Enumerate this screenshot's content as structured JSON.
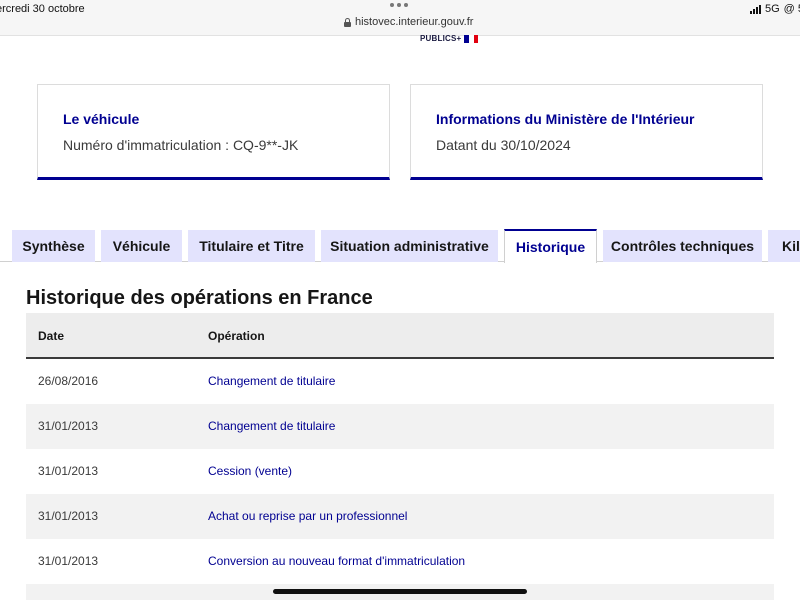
{
  "status": {
    "date": "ercredi 30 octobre",
    "url": "histovec.interieur.gouv.fr",
    "network": "5G",
    "extra": "@ 5"
  },
  "logo": {
    "text": "PUBLICS+"
  },
  "cards": [
    {
      "title": "Le véhicule",
      "text": "Numéro d'immatriculation : CQ-9**-JK"
    },
    {
      "title": "Informations du Ministère de l'Intérieur",
      "text": "Datant du 30/10/2024"
    }
  ],
  "tabs": [
    {
      "label": "Synthèse",
      "active": false
    },
    {
      "label": "Véhicule",
      "active": false
    },
    {
      "label": "Titulaire et Titre",
      "active": false
    },
    {
      "label": "Situation administrative",
      "active": false
    },
    {
      "label": "Historique",
      "active": true
    },
    {
      "label": "Contrôles techniques",
      "active": false
    },
    {
      "label": "Kil",
      "active": false
    }
  ],
  "section": {
    "title": "Historique des opérations en France"
  },
  "table": {
    "headers": {
      "date": "Date",
      "operation": "Opération"
    },
    "rows": [
      {
        "date": "26/08/2016",
        "operation": "Changement de titulaire"
      },
      {
        "date": "31/01/2013",
        "operation": "Changement de titulaire"
      },
      {
        "date": "31/01/2013",
        "operation": "Cession (vente)"
      },
      {
        "date": "31/01/2013",
        "operation": "Achat ou reprise par un professionnel"
      },
      {
        "date": "31/01/2013",
        "operation": "Conversion au nouveau format d'immatriculation"
      },
      {
        "date": "",
        "operation": ""
      }
    ]
  },
  "colors": {
    "accent": "#000091",
    "tab_bg": "#e3e3fd",
    "row_alt": "#f2f2f2"
  }
}
